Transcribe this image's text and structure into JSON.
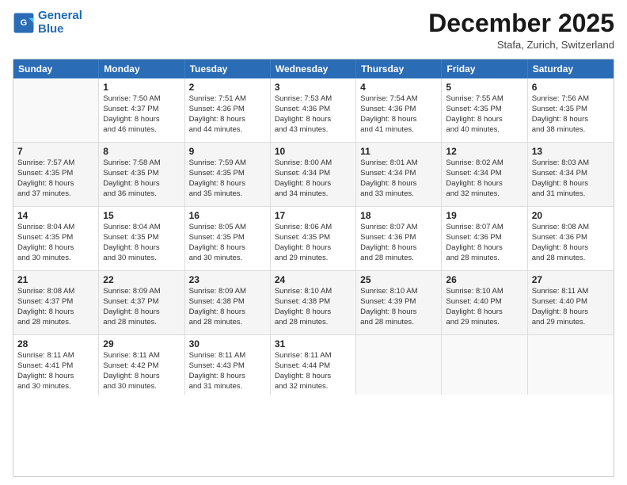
{
  "header": {
    "logo_line1": "General",
    "logo_line2": "Blue",
    "month": "December 2025",
    "location": "Stafa, Zurich, Switzerland"
  },
  "days_of_week": [
    "Sunday",
    "Monday",
    "Tuesday",
    "Wednesday",
    "Thursday",
    "Friday",
    "Saturday"
  ],
  "weeks": [
    [
      {
        "day": "",
        "info": ""
      },
      {
        "day": "1",
        "info": "Sunrise: 7:50 AM\nSunset: 4:37 PM\nDaylight: 8 hours\nand 46 minutes."
      },
      {
        "day": "2",
        "info": "Sunrise: 7:51 AM\nSunset: 4:36 PM\nDaylight: 8 hours\nand 44 minutes."
      },
      {
        "day": "3",
        "info": "Sunrise: 7:53 AM\nSunset: 4:36 PM\nDaylight: 8 hours\nand 43 minutes."
      },
      {
        "day": "4",
        "info": "Sunrise: 7:54 AM\nSunset: 4:36 PM\nDaylight: 8 hours\nand 41 minutes."
      },
      {
        "day": "5",
        "info": "Sunrise: 7:55 AM\nSunset: 4:35 PM\nDaylight: 8 hours\nand 40 minutes."
      },
      {
        "day": "6",
        "info": "Sunrise: 7:56 AM\nSunset: 4:35 PM\nDaylight: 8 hours\nand 38 minutes."
      }
    ],
    [
      {
        "day": "7",
        "info": "Sunrise: 7:57 AM\nSunset: 4:35 PM\nDaylight: 8 hours\nand 37 minutes."
      },
      {
        "day": "8",
        "info": "Sunrise: 7:58 AM\nSunset: 4:35 PM\nDaylight: 8 hours\nand 36 minutes."
      },
      {
        "day": "9",
        "info": "Sunrise: 7:59 AM\nSunset: 4:35 PM\nDaylight: 8 hours\nand 35 minutes."
      },
      {
        "day": "10",
        "info": "Sunrise: 8:00 AM\nSunset: 4:34 PM\nDaylight: 8 hours\nand 34 minutes."
      },
      {
        "day": "11",
        "info": "Sunrise: 8:01 AM\nSunset: 4:34 PM\nDaylight: 8 hours\nand 33 minutes."
      },
      {
        "day": "12",
        "info": "Sunrise: 8:02 AM\nSunset: 4:34 PM\nDaylight: 8 hours\nand 32 minutes."
      },
      {
        "day": "13",
        "info": "Sunrise: 8:03 AM\nSunset: 4:34 PM\nDaylight: 8 hours\nand 31 minutes."
      }
    ],
    [
      {
        "day": "14",
        "info": "Sunrise: 8:04 AM\nSunset: 4:35 PM\nDaylight: 8 hours\nand 30 minutes."
      },
      {
        "day": "15",
        "info": "Sunrise: 8:04 AM\nSunset: 4:35 PM\nDaylight: 8 hours\nand 30 minutes."
      },
      {
        "day": "16",
        "info": "Sunrise: 8:05 AM\nSunset: 4:35 PM\nDaylight: 8 hours\nand 30 minutes."
      },
      {
        "day": "17",
        "info": "Sunrise: 8:06 AM\nSunset: 4:35 PM\nDaylight: 8 hours\nand 29 minutes."
      },
      {
        "day": "18",
        "info": "Sunrise: 8:07 AM\nSunset: 4:36 PM\nDaylight: 8 hours\nand 28 minutes."
      },
      {
        "day": "19",
        "info": "Sunrise: 8:07 AM\nSunset: 4:36 PM\nDaylight: 8 hours\nand 28 minutes."
      },
      {
        "day": "20",
        "info": "Sunrise: 8:08 AM\nSunset: 4:36 PM\nDaylight: 8 hours\nand 28 minutes."
      }
    ],
    [
      {
        "day": "21",
        "info": "Sunrise: 8:08 AM\nSunset: 4:37 PM\nDaylight: 8 hours\nand 28 minutes."
      },
      {
        "day": "22",
        "info": "Sunrise: 8:09 AM\nSunset: 4:37 PM\nDaylight: 8 hours\nand 28 minutes."
      },
      {
        "day": "23",
        "info": "Sunrise: 8:09 AM\nSunset: 4:38 PM\nDaylight: 8 hours\nand 28 minutes."
      },
      {
        "day": "24",
        "info": "Sunrise: 8:10 AM\nSunset: 4:38 PM\nDaylight: 8 hours\nand 28 minutes."
      },
      {
        "day": "25",
        "info": "Sunrise: 8:10 AM\nSunset: 4:39 PM\nDaylight: 8 hours\nand 28 minutes."
      },
      {
        "day": "26",
        "info": "Sunrise: 8:10 AM\nSunset: 4:40 PM\nDaylight: 8 hours\nand 29 minutes."
      },
      {
        "day": "27",
        "info": "Sunrise: 8:11 AM\nSunset: 4:40 PM\nDaylight: 8 hours\nand 29 minutes."
      }
    ],
    [
      {
        "day": "28",
        "info": "Sunrise: 8:11 AM\nSunset: 4:41 PM\nDaylight: 8 hours\nand 30 minutes."
      },
      {
        "day": "29",
        "info": "Sunrise: 8:11 AM\nSunset: 4:42 PM\nDaylight: 8 hours\nand 30 minutes."
      },
      {
        "day": "30",
        "info": "Sunrise: 8:11 AM\nSunset: 4:43 PM\nDaylight: 8 hours\nand 31 minutes."
      },
      {
        "day": "31",
        "info": "Sunrise: 8:11 AM\nSunset: 4:44 PM\nDaylight: 8 hours\nand 32 minutes."
      },
      {
        "day": "",
        "info": ""
      },
      {
        "day": "",
        "info": ""
      },
      {
        "day": "",
        "info": ""
      }
    ]
  ]
}
